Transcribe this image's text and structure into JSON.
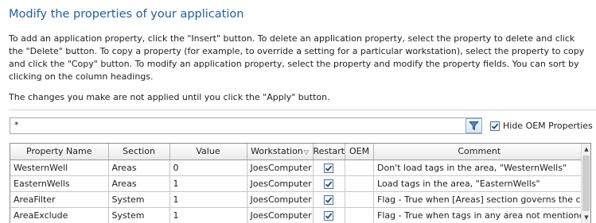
{
  "page": {
    "title": "Modify the properties of your application",
    "description": "To add an application property, click the \"Insert\" button. To delete an application property, select the property to delete and click the \"Delete\" button. To copy a property (for example, to override a setting for a particular workstation), select the property to copy and click the \"Copy\" button. To modify an application property, select the property and modify the property fields. You can sort by clicking on the column headings.",
    "note": "The changes you make are not applied until you click the \"Apply\" button."
  },
  "filter": {
    "value": "*",
    "button_icon": "filter-funnel-icon",
    "hide_oem_label": "Hide OEM Properties",
    "hide_oem_checked": true
  },
  "grid": {
    "columns": [
      "Property Name",
      "Section",
      "Value",
      "Workstation",
      "Restart",
      "OEM",
      "Comment"
    ],
    "sorted_column": "Workstation",
    "rows": [
      {
        "name": "WesternWell",
        "section": "Areas",
        "value": "0",
        "workstation": "JoesComputer",
        "restart": true,
        "oem": "",
        "comment": "Don't load tags in the area, \"WesternWells\""
      },
      {
        "name": "EasternWells",
        "section": "Areas",
        "value": "1",
        "workstation": "JoesComputer",
        "restart": true,
        "oem": "",
        "comment": "Load tags in the area, \"EasternWells\""
      },
      {
        "name": "AreaFilter",
        "section": "System",
        "value": "1",
        "workstation": "JoesComputer",
        "restart": true,
        "oem": "",
        "comment": "Flag - True when [Areas] section governs the cr"
      },
      {
        "name": "AreaExclude",
        "section": "System",
        "value": "1",
        "workstation": "JoesComputer",
        "restart": true,
        "oem": "",
        "comment": "Flag - True when tags in any area not mentione"
      }
    ]
  },
  "colors": {
    "title": "#1f5fa8",
    "checkmark": "#1c3f8c",
    "grid_border": "#8c8c8c"
  }
}
